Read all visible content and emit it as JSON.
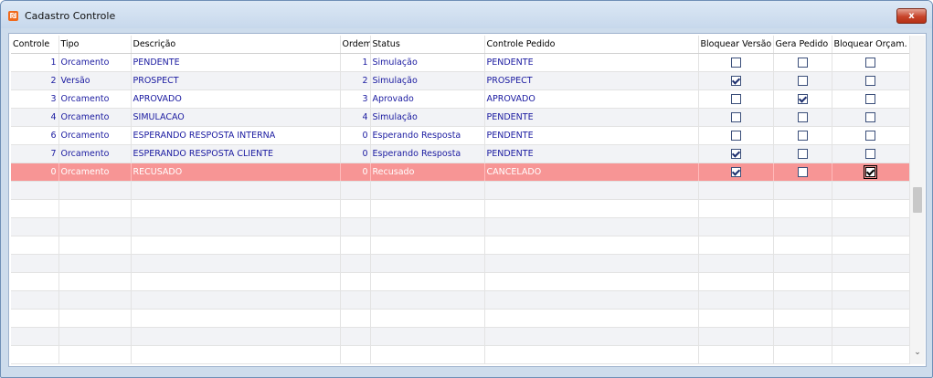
{
  "window": {
    "title": "Cadastro Controle",
    "close_label": "x"
  },
  "columns": [
    "Controle",
    "Tipo",
    "Descrição",
    "Ordem",
    "Status",
    "Controle Pedido",
    "Bloquear Versão",
    "Gera Pedido",
    "Bloquear Orçam."
  ],
  "rows": [
    {
      "controle": "1",
      "tipo": "Orcamento",
      "descricao": "PENDENTE",
      "ordem": "1",
      "status": "Simulação",
      "controle_pedido": "PENDENTE",
      "bloquear_versao": false,
      "gera_pedido": false,
      "bloquear_orcam": false
    },
    {
      "controle": "2",
      "tipo": "Versão",
      "descricao": "PROSPECT",
      "ordem": "2",
      "status": "Simulação",
      "controle_pedido": "PROSPECT",
      "bloquear_versao": true,
      "gera_pedido": false,
      "bloquear_orcam": false
    },
    {
      "controle": "3",
      "tipo": "Orcamento",
      "descricao": "APROVADO",
      "ordem": "3",
      "status": "Aprovado",
      "controle_pedido": "APROVADO",
      "bloquear_versao": false,
      "gera_pedido": true,
      "bloquear_orcam": false
    },
    {
      "controle": "4",
      "tipo": "Orcamento",
      "descricao": "SIMULACAO",
      "ordem": "4",
      "status": "Simulação",
      "controle_pedido": "PENDENTE",
      "bloquear_versao": false,
      "gera_pedido": false,
      "bloquear_orcam": false
    },
    {
      "controle": "6",
      "tipo": "Orcamento",
      "descricao": "ESPERANDO RESPOSTA INTERNA",
      "ordem": "0",
      "status": "Esperando Resposta",
      "controle_pedido": "PENDENTE",
      "bloquear_versao": false,
      "gera_pedido": false,
      "bloquear_orcam": false
    },
    {
      "controle": "7",
      "tipo": "Orcamento",
      "descricao": "ESPERANDO RESPOSTA CLIENTE",
      "ordem": "0",
      "status": "Esperando Resposta",
      "controle_pedido": "PENDENTE",
      "bloquear_versao": true,
      "gera_pedido": false,
      "bloquear_orcam": false
    },
    {
      "controle": "0",
      "tipo": "Orcamento",
      "descricao": "RECUSADO",
      "ordem": "0",
      "status": "Recusado",
      "controle_pedido": "CANCELADO",
      "bloquear_versao": true,
      "gera_pedido": false,
      "bloquear_orcam": true,
      "selected": true
    }
  ],
  "colors": {
    "selected_row": "#f79595",
    "text": "#1a1aa0",
    "title_bar": "#c7d8ec",
    "close_button": "#c7432a"
  },
  "icons": {
    "app": "app-logo-icon",
    "close": "close-icon",
    "scroll_down": "chevron-down-icon"
  }
}
